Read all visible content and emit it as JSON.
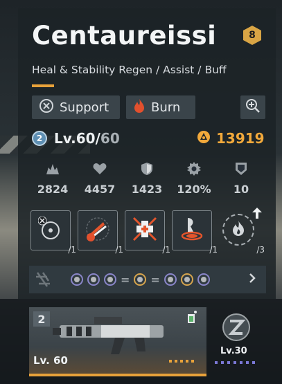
{
  "character": {
    "name": "Centaureissi",
    "rank": "8",
    "role_description": "Heal & Stability Regen / Assist / Buff"
  },
  "tags": [
    {
      "label": "Support",
      "icon": "support-class-icon"
    },
    {
      "label": "Burn",
      "icon": "flame-icon"
    }
  ],
  "level": {
    "badge": "2",
    "prefix": "Lv.",
    "current": "60",
    "separator": "/",
    "max": "60"
  },
  "power": "13919",
  "stats": [
    {
      "icon": "attack-icon",
      "value": "2824"
    },
    {
      "icon": "heart-icon",
      "value": "4457"
    },
    {
      "icon": "defense-icon",
      "value": "1423"
    },
    {
      "icon": "gear-icon",
      "value": "120%"
    },
    {
      "icon": "shield-icon",
      "value": "10"
    }
  ],
  "skills": [
    {
      "icon": "target-icon",
      "count": "/1"
    },
    {
      "icon": "slash-fire-icon",
      "count": "/1"
    },
    {
      "icon": "heal-cross-icon",
      "count": "/1"
    },
    {
      "icon": "beam-icon",
      "count": "/1"
    },
    {
      "icon": "ultimate-flame-icon",
      "count": "/3"
    }
  ],
  "weapon": {
    "slot": "2",
    "level": "Lv. 60"
  },
  "core": {
    "level": "Lv.30"
  },
  "colors": {
    "accent": "#e8a23a",
    "power": "#f2a93b",
    "mod_purple": "#8a86c9",
    "mod_gold": "#d7a54d"
  }
}
